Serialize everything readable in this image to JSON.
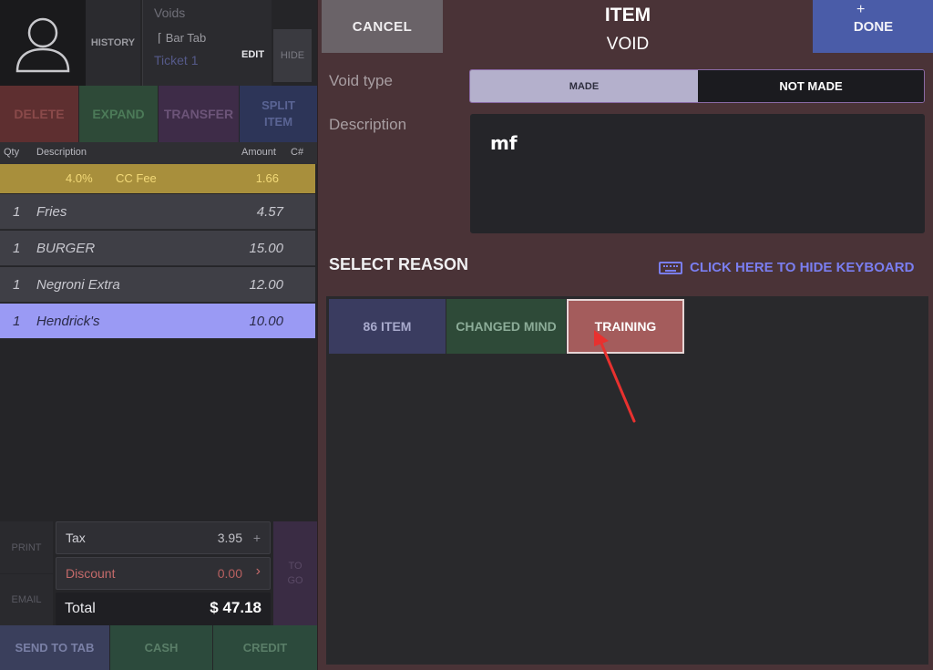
{
  "ticket": {
    "history_label": "HISTORY",
    "voids_label": "Voids",
    "bar_tab_label": "Bar Tab",
    "ticket_label": "Ticket 1",
    "edit_label": "EDIT",
    "hide_label": "HIDE"
  },
  "actions": {
    "delete": "DELETE",
    "expand": "EXPAND",
    "transfer": "TRANSFER",
    "split_line1": "SPLIT",
    "split_line2": "ITEM"
  },
  "order": {
    "headers": {
      "qty": "Qty",
      "description": "Description",
      "amount": "Amount",
      "c": "C#"
    },
    "cc_fee": {
      "percent": "4.0%",
      "label": "CC Fee",
      "amount": "1.66"
    },
    "items": [
      {
        "qty": "1",
        "description": "Fries",
        "amount": "4.57"
      },
      {
        "qty": "1",
        "description": "BURGER",
        "amount": "15.00"
      },
      {
        "qty": "1",
        "description": "Negroni Extra",
        "amount": "12.00"
      },
      {
        "qty": "1",
        "description": "Hendrick's",
        "amount": "10.00",
        "selected": true
      }
    ]
  },
  "summary": {
    "print": "PRINT",
    "email": "EMAIL",
    "tax_label": "Tax",
    "tax_value": "3.95",
    "discount_label": "Discount",
    "discount_value": "0.00",
    "total_label": "Total",
    "total_value": "$ 47.18",
    "togo_line1": "TO",
    "togo_line2": "GO"
  },
  "payment": {
    "send_to_tab": "SEND TO TAB",
    "cash": "CASH",
    "credit": "CREDIT"
  },
  "void_dialog": {
    "cancel": "CANCEL",
    "title_line1": "ITEM",
    "title_line2": "VOID",
    "done": "DONE",
    "void_type_label": "Void type",
    "made": "MADE",
    "not_made": "NOT MADE",
    "void_type_selected": "NOT MADE",
    "description_label": "Description",
    "description_value": "mf",
    "select_reason": "SELECT REASON",
    "hide_keyboard": "CLICK HERE TO HIDE KEYBOARD",
    "reasons": [
      "86 ITEM",
      "CHANGED MIND",
      "TRAINING"
    ],
    "selected_reason": "TRAINING"
  },
  "colors": {
    "cc_fee_row": "#a88f3c",
    "selected_row": "#9a9af4",
    "done_button": "#4a5ca8",
    "training_button": "#a45c5c",
    "arrow": "#e8312f"
  },
  "icons": [
    "user-avatar-icon",
    "pin-icon",
    "plus-icon",
    "chevron-right-icon",
    "keyboard-icon",
    "arrow-annotation"
  ]
}
